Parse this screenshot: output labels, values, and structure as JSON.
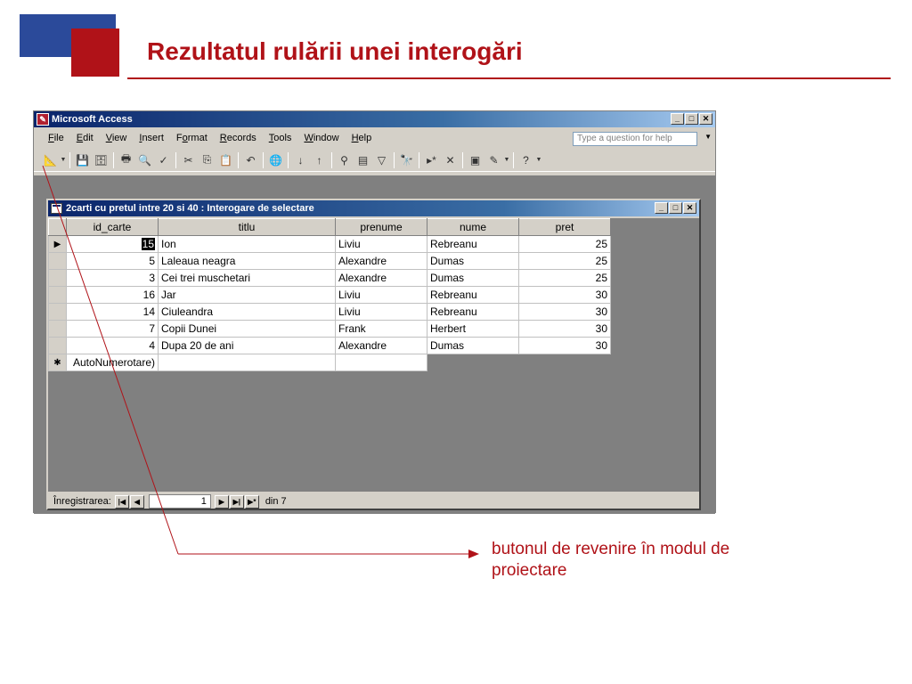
{
  "slide": {
    "title": "Rezultatul rulării unei interogări",
    "annotation": "butonul de revenire în modul de proiectare",
    "accent_color": "#b01218",
    "deco_color": "#2b4a9a"
  },
  "app": {
    "title": "Microsoft Access",
    "icon": "access-key-icon",
    "menu": [
      {
        "u": "F",
        "rest": "ile"
      },
      {
        "u": "E",
        "rest": "dit"
      },
      {
        "u": "V",
        "rest": "iew"
      },
      {
        "u": "I",
        "rest": "nsert"
      },
      {
        "pre": "F",
        "u": "o",
        "rest": "rmat"
      },
      {
        "u": "R",
        "rest": "ecords"
      },
      {
        "u": "T",
        "rest": "ools"
      },
      {
        "u": "W",
        "rest": "indow"
      },
      {
        "u": "H",
        "rest": "elp"
      }
    ],
    "help_placeholder": "Type a question for help",
    "toolbar_icons": [
      "design-view-icon",
      "save-icon",
      "database-icon",
      "print-icon",
      "print-preview-icon",
      "spelling-icon",
      "cut-icon",
      "copy-icon",
      "paste-icon",
      "undo-icon",
      "hyperlink-icon",
      "sort-ascending-icon",
      "sort-descending-icon",
      "filter-by-selection-icon",
      "filter-by-form-icon",
      "apply-filter-icon",
      "find-icon",
      "new-record-icon",
      "delete-record-icon",
      "database-window-icon",
      "new-object-icon",
      "help-icon"
    ]
  },
  "query_window": {
    "title": "2carti cu pretul intre 20 si 40 : Interogare de selectare",
    "columns": [
      "id_carte",
      "titlu",
      "prenume",
      "nume",
      "pret"
    ],
    "rows": [
      {
        "id_carte": "15",
        "titlu": "Ion",
        "prenume": "Liviu",
        "nume": "Rebreanu",
        "pret": "25"
      },
      {
        "id_carte": "5",
        "titlu": "Laleaua neagra",
        "prenume": "Alexandre",
        "nume": "Dumas",
        "pret": "25"
      },
      {
        "id_carte": "3",
        "titlu": "Cei trei muschetari",
        "prenume": "Alexandre",
        "nume": "Dumas",
        "pret": "25"
      },
      {
        "id_carte": "16",
        "titlu": "Jar",
        "prenume": "Liviu",
        "nume": "Rebreanu",
        "pret": "30"
      },
      {
        "id_carte": "14",
        "titlu": "Ciuleandra",
        "prenume": "Liviu",
        "nume": "Rebreanu",
        "pret": "30"
      },
      {
        "id_carte": "7",
        "titlu": "Copii Dunei",
        "prenume": "Frank",
        "nume": "Herbert",
        "pret": "30"
      },
      {
        "id_carte": "4",
        "titlu": "Dupa 20 de ani",
        "prenume": "Alexandre",
        "nume": "Dumas",
        "pret": "30"
      }
    ],
    "new_row_placeholder": "AutoNumerotare)",
    "nav": {
      "label": "Înregistrarea:",
      "current": "1",
      "total_label": "din 7"
    }
  }
}
